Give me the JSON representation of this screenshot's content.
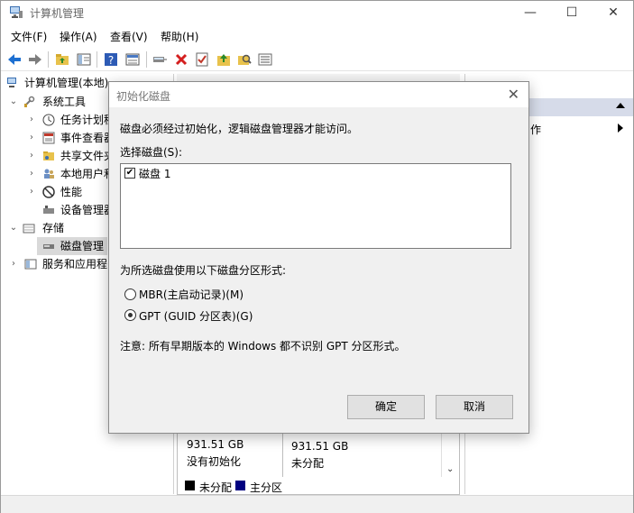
{
  "window": {
    "title": "计算机管理",
    "min_glyph": "—",
    "max_glyph": "☐",
    "close_glyph": "✕"
  },
  "menu": [
    "文件(F)",
    "操作(A)",
    "查看(V)",
    "帮助(H)"
  ],
  "toolbar_icons": [
    "back-arrow-icon",
    "forward-arrow-icon",
    "up-folder-icon",
    "show-hide-tree-icon",
    "help-icon",
    "properties-icon",
    "connect-icon",
    "delete-icon",
    "check-icon",
    "import-icon",
    "search-folder-icon",
    "list-icon"
  ],
  "tree": {
    "root": "计算机管理(本地)",
    "system_tools": "系统工具",
    "task_scheduler": "任务计划程",
    "event_viewer": "事件查看器",
    "shared_folders": "共享文件夹",
    "local_users": "本地用户和",
    "performance": "性能",
    "device_manager": "设备管理器",
    "storage": "存储",
    "disk_management": "磁盘管理",
    "services_apps": "服务和应用程"
  },
  "actions": {
    "item_fragment": "作"
  },
  "disks": [
    {
      "size": "931.51 GB",
      "status": "没有初始化"
    },
    {
      "size": "931.51 GB",
      "status": "未分配"
    }
  ],
  "legend": [
    {
      "label": "未分配",
      "color": "#000000"
    },
    {
      "label": "主分区",
      "color": "#000080"
    }
  ],
  "dialog": {
    "title": "初始化磁盘",
    "message": "磁盘必须经过初始化，逻辑磁盘管理器才能访问。",
    "select_label": "选择磁盘(S):",
    "disk_item": "磁盘 1",
    "disk_item_checked": true,
    "style_label": "为所选磁盘使用以下磁盘分区形式:",
    "option_mbr": "MBR(主启动记录)(M)",
    "option_gpt": "GPT (GUID 分区表)(G)",
    "selected_option": "GPT",
    "note": "注意: 所有早期版本的 Windows 都不识别 GPT 分区形式。",
    "ok": "确定",
    "cancel": "取消",
    "close_glyph": "✕"
  },
  "colors": {
    "dialog_bg": "#f0f0f0",
    "actions_header": "#d6dbe9",
    "tree_selected": "#d9d9d9",
    "nav_arrow": "#1c6fd1",
    "delete_red": "#d41f1f"
  }
}
